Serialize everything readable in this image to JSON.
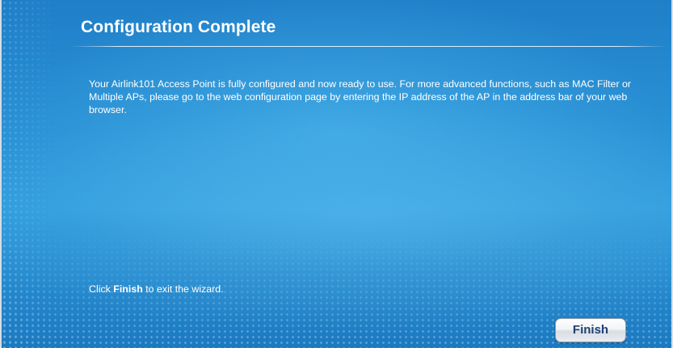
{
  "header": {
    "title": "Configuration Complete"
  },
  "main": {
    "description": "Your Airlink101 Access Point is fully configured and now ready to use. For more advanced functions, such as MAC Filter or Multiple APs, please go to the web configuration page by entering the IP address of the AP in the address bar of your web browser.",
    "instruction": {
      "prefix": "Click ",
      "emphasis": "Finish",
      "suffix": " to exit the wizard."
    }
  },
  "footer": {
    "finish_label": "Finish"
  },
  "colors": {
    "background": "#2b93d6",
    "text": "#ffffff",
    "button_text": "#1f3f73"
  }
}
